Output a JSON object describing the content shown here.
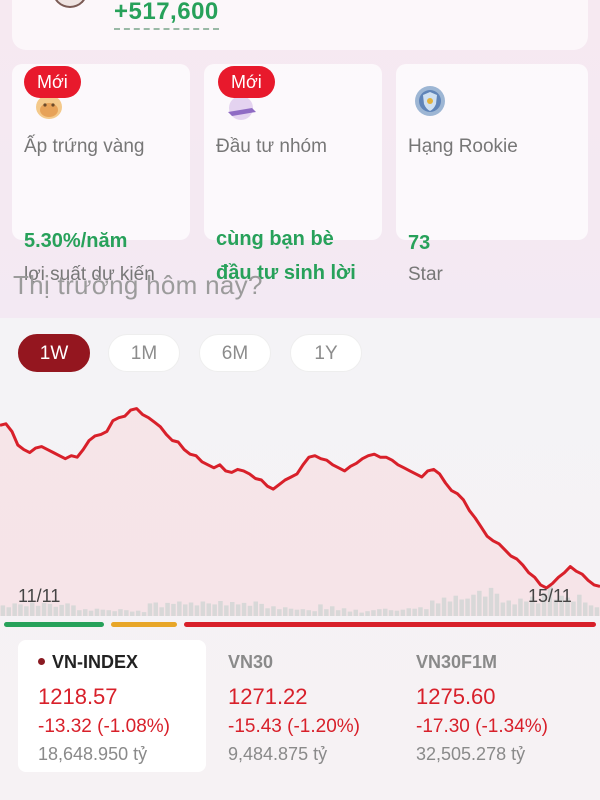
{
  "header": {
    "gain_value": "+517,600"
  },
  "promos": [
    {
      "badge": "Mới",
      "label": "Ấp trứng vàng",
      "value": "5.30%/năm",
      "sub": "lợi suất dự kiến",
      "icon": "golden-egg-icon"
    },
    {
      "badge": "Mới",
      "label": "Đầu tư nhóm",
      "value_line1": "cùng bạn bè",
      "value_line2": "đầu tư sinh lời",
      "icon": "group-invest-icon"
    },
    {
      "label": "Hạng Rookie",
      "value": "73",
      "sub": "Star",
      "icon": "rank-shield-icon"
    }
  ],
  "market": {
    "title": "Thị trường hôm nay?",
    "periods": [
      "1W",
      "1M",
      "6M",
      "1Y"
    ],
    "active_period": "1W"
  },
  "chart_data": {
    "type": "line",
    "series": [
      {
        "values": [
          1256,
          1257,
          1252,
          1243,
          1240,
          1238,
          1241,
          1242,
          1240,
          1238,
          1236,
          1234,
          1236,
          1235,
          1240,
          1246,
          1249,
          1250,
          1252,
          1259,
          1261,
          1262,
          1266,
          1267,
          1263,
          1261,
          1258,
          1255,
          1250,
          1246,
          1245,
          1240,
          1237,
          1236,
          1232,
          1230,
          1228,
          1230,
          1226,
          1225,
          1227,
          1226,
          1224,
          1221,
          1220,
          1216,
          1214,
          1217,
          1220,
          1222,
          1224,
          1230,
          1235,
          1236,
          1234,
          1233,
          1230,
          1228,
          1226,
          1229,
          1231,
          1234,
          1236,
          1237,
          1235,
          1235,
          1233,
          1230,
          1228,
          1226,
          1224,
          1222,
          1226,
          1227,
          1224,
          1218,
          1213,
          1211,
          1207,
          1200,
          1195,
          1189,
          1183,
          1180,
          1178,
          1174,
          1170,
          1168,
          1164,
          1159,
          1156,
          1151,
          1149,
          1152,
          1156,
          1159,
          1163,
          1160,
          1158,
          1154,
          1151,
          1150
        ]
      }
    ],
    "volume": [
      22,
      18,
      26,
      24,
      20,
      28,
      21,
      27,
      25,
      19,
      23,
      26,
      22,
      12,
      14,
      11,
      15,
      13,
      12,
      10,
      14,
      12,
      9,
      11,
      8,
      26,
      28,
      18,
      27,
      25,
      30,
      24,
      28,
      22,
      30,
      26,
      24,
      31,
      22,
      29,
      24,
      27,
      21,
      30,
      25,
      16,
      20,
      14,
      18,
      15,
      13,
      14,
      12,
      10,
      24,
      14,
      20,
      12,
      16,
      9,
      13,
      7,
      10,
      12,
      14,
      15,
      12,
      11,
      13,
      16,
      15,
      18,
      14,
      32,
      26,
      38,
      30,
      42,
      34,
      36,
      44,
      52,
      40,
      58,
      46,
      28,
      32,
      24,
      36,
      30,
      40,
      26,
      48,
      62,
      34,
      42,
      38,
      30,
      44,
      28,
      22,
      18
    ],
    "x_labels": [
      "11/11",
      "15/11"
    ],
    "segments": [
      {
        "color": "#27a15a"
      },
      {
        "color": "#e8a628"
      },
      {
        "color": "#d8202a"
      }
    ],
    "colors": {
      "line": "#d8202a",
      "fill": "#f6d9dc",
      "volume": "#d8d8d8"
    }
  },
  "indices": [
    {
      "name": "VN-INDEX",
      "value": "1218.57",
      "change": "-13.32 (-1.08%)",
      "volume": "18,648.950 tỷ",
      "active": true
    },
    {
      "name": "VN30",
      "value": "1271.22",
      "change": "-15.43 (-1.20%)",
      "volume": "9,484.875 tỷ",
      "active": false
    },
    {
      "name": "VN30F1M",
      "value": "1275.60",
      "change": "-17.30 (-1.34%)",
      "volume": "32,505.278 tỷ",
      "active": false
    }
  ],
  "colors": {
    "accent": "#94161f",
    "positive": "#27a15a",
    "negative": "#d8202a",
    "badge": "#e8192c"
  }
}
